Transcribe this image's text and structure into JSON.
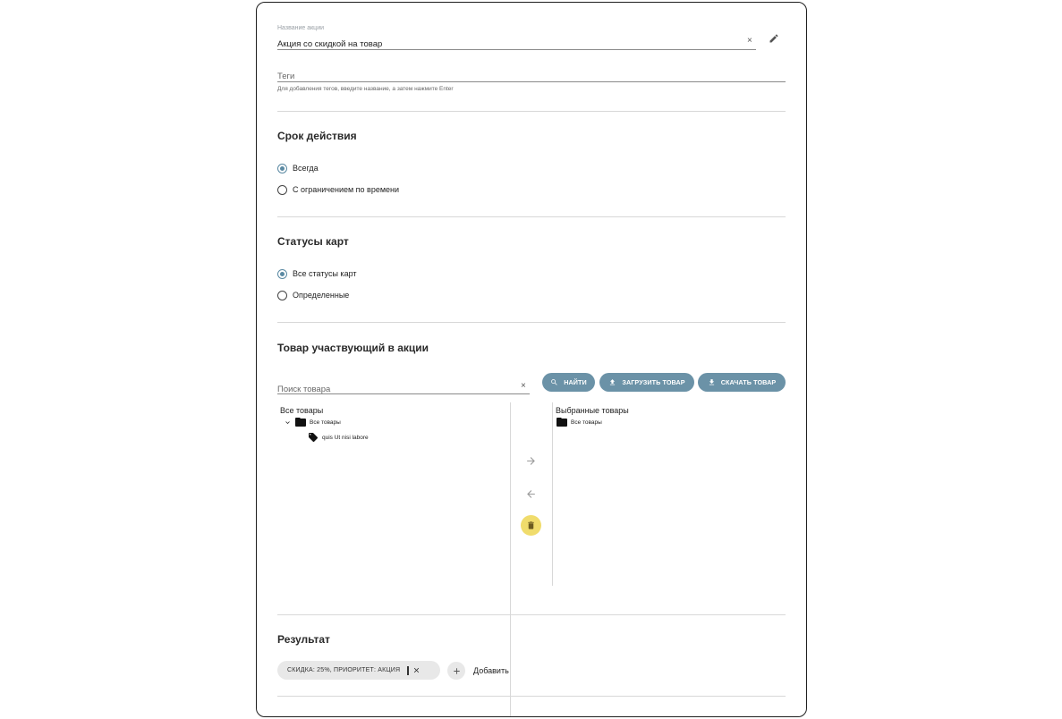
{
  "promo_name": {
    "label": "Название акции",
    "value": "Акция со скидкой на товар",
    "clear_icon": "close-icon",
    "edit_icon": "pencil-icon"
  },
  "tags": {
    "placeholder": "Теги",
    "hint": "Для добавления тегов, введите название, а затем нажмите Enter"
  },
  "validity": {
    "title": "Срок действия",
    "options": [
      {
        "label": "Всегда",
        "checked": true
      },
      {
        "label": "С ограничением по времени",
        "checked": false
      }
    ]
  },
  "card_statuses": {
    "title": "Статусы карт",
    "options": [
      {
        "label": "Все статусы карт",
        "checked": true
      },
      {
        "label": "Определенные",
        "checked": false
      }
    ]
  },
  "products": {
    "title": "Товар участвующий в акции",
    "search_placeholder": "Поиск товара",
    "buttons": {
      "find": "НАЙТИ",
      "upload": "ЗАГРУЗИТЬ ТОВАР",
      "download": "СКАЧАТЬ ТОВАР"
    },
    "all_tree": {
      "title": "Все товары",
      "root": "Все товары",
      "child": "quis Ut nisi labore"
    },
    "selected_tree": {
      "title": "Выбранные товары",
      "root": "Все товары"
    }
  },
  "result": {
    "title": "Результат",
    "chip": "СКИДКА: 25%, ПРИОРИТЕТ: АКЦИЯ",
    "add_label": "Добавить"
  },
  "colors": {
    "accent": "#6b92a7",
    "trash_bg": "#f0dc6c",
    "chip_bg": "#e8e8e8"
  }
}
